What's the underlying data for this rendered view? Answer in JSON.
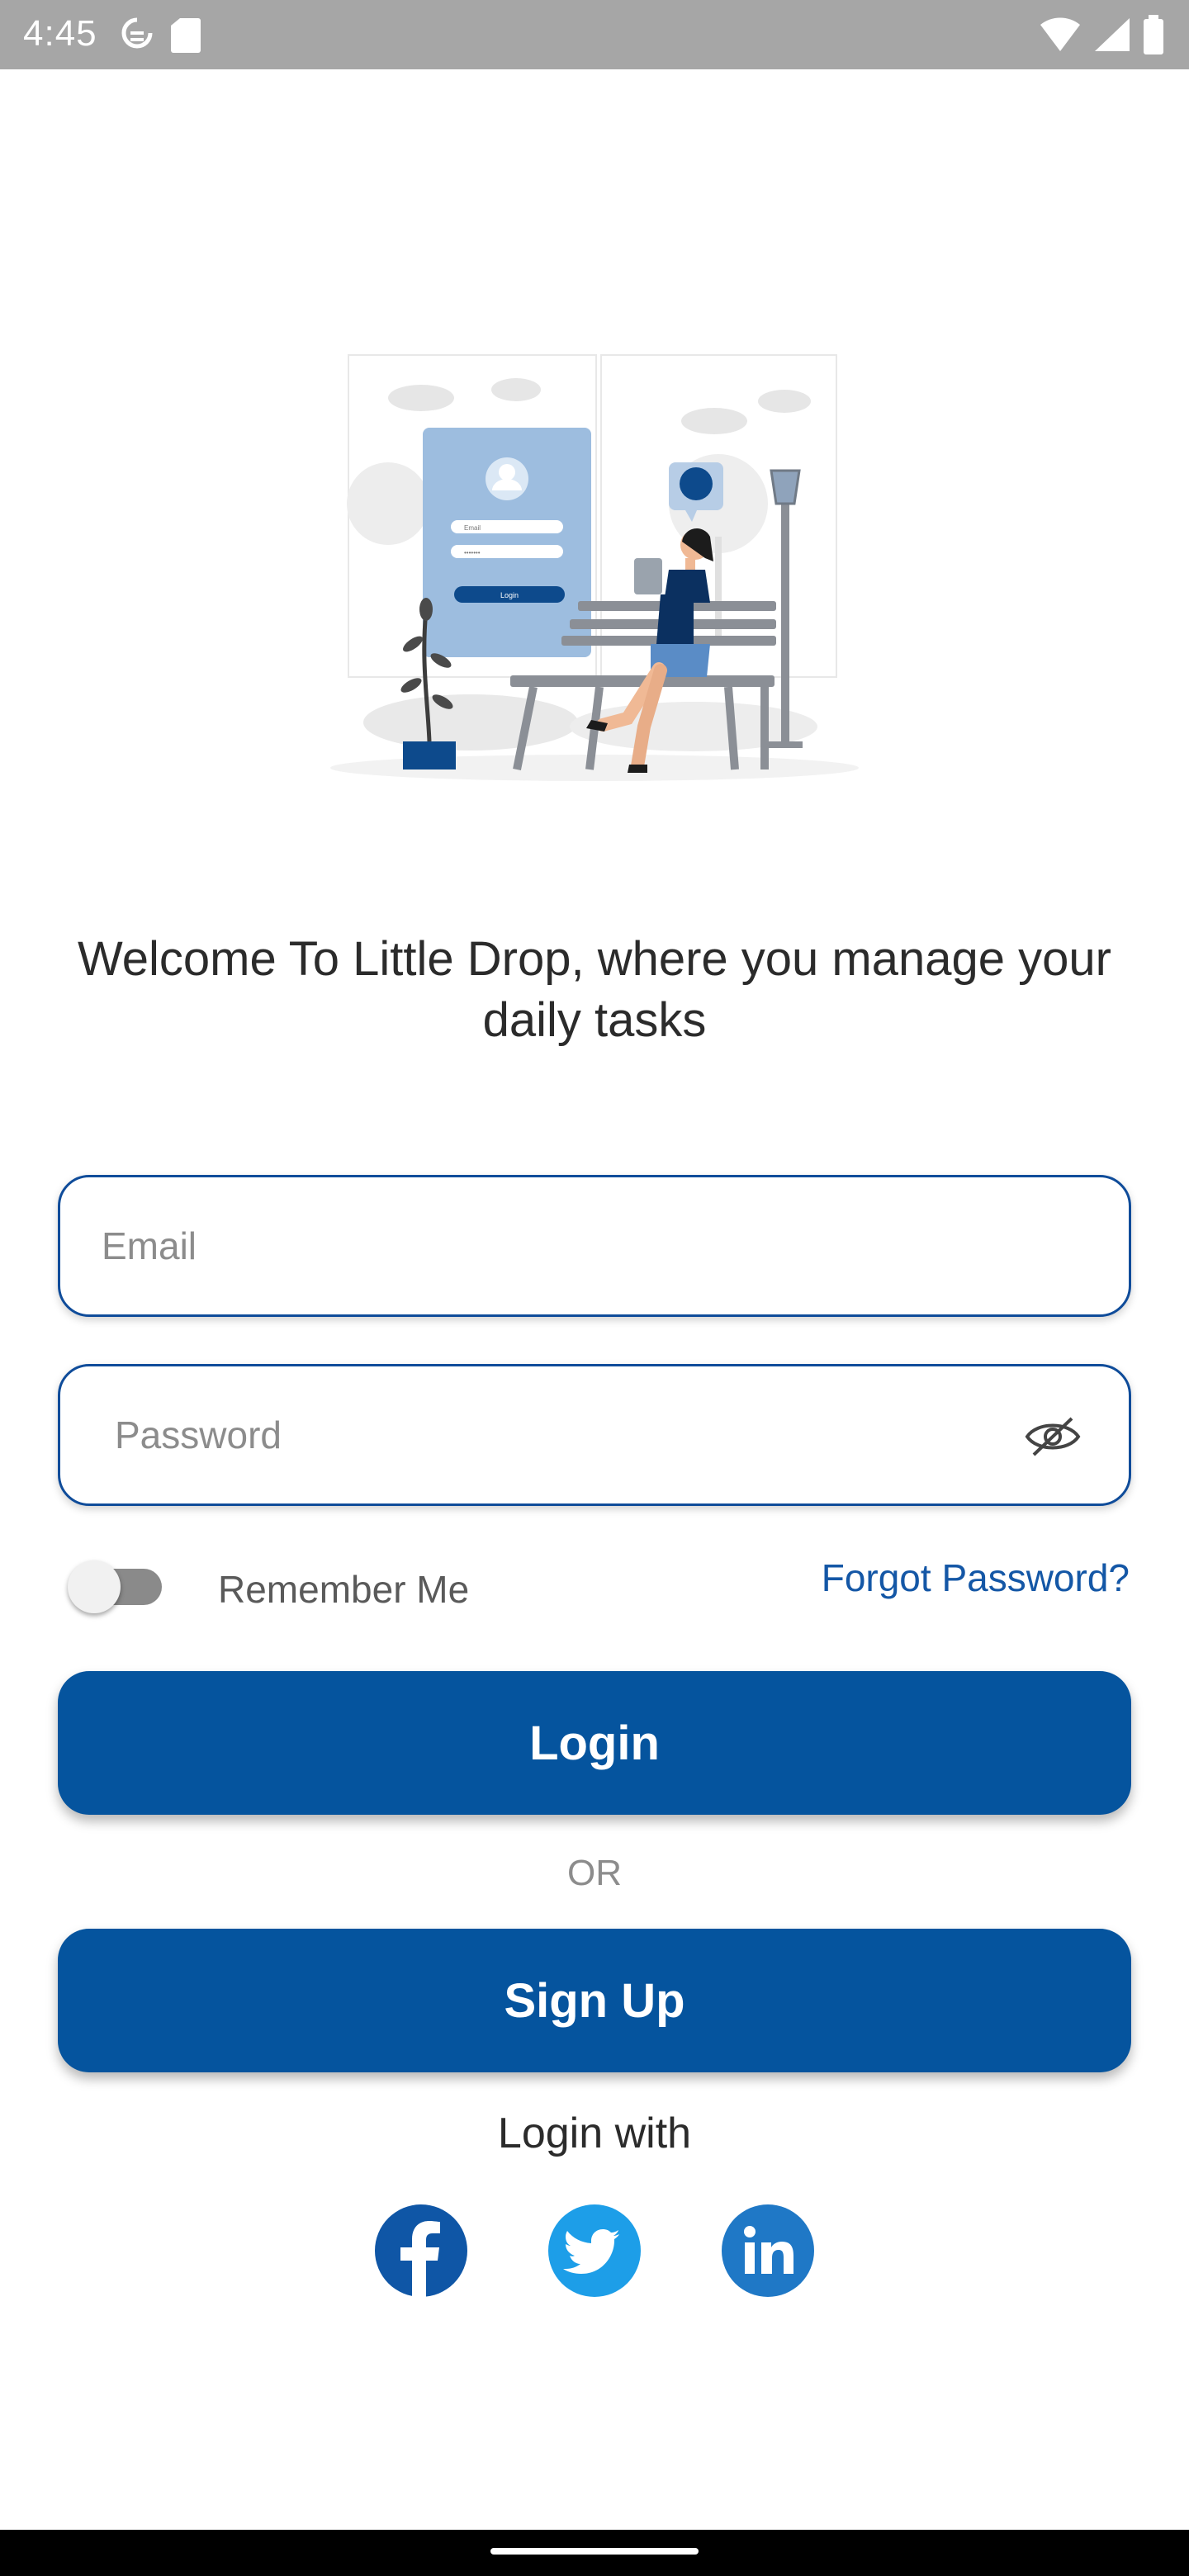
{
  "status_bar": {
    "time": "4:45",
    "icons": [
      "sync-icon",
      "sd-card-icon",
      "wifi-icon",
      "signal-icon",
      "battery-icon"
    ]
  },
  "illustration": {
    "name": "login-illustration",
    "mock_screen": {
      "email_text": "Email",
      "password_text": "•••••••",
      "button_text": "Login"
    }
  },
  "welcome_text": "Welcome To Little Drop, where you manage your daily tasks",
  "form": {
    "email_placeholder": "Email",
    "email_value": "",
    "password_placeholder": "Password",
    "password_value": "",
    "remember_label": "Remember Me",
    "remember_on": false,
    "forgot_label": "Forgot Password?"
  },
  "buttons": {
    "login_label": "Login",
    "or_text": "OR",
    "signup_label": "Sign Up"
  },
  "social": {
    "heading": "Login with",
    "providers": [
      "facebook-icon",
      "twitter-icon",
      "linkedin-icon"
    ]
  },
  "colors": {
    "primary": "#05549e",
    "link": "#1457a6",
    "facebook": "#0f56a6",
    "twitter": "#1d9ee8",
    "linkedin": "#1f78c6"
  }
}
